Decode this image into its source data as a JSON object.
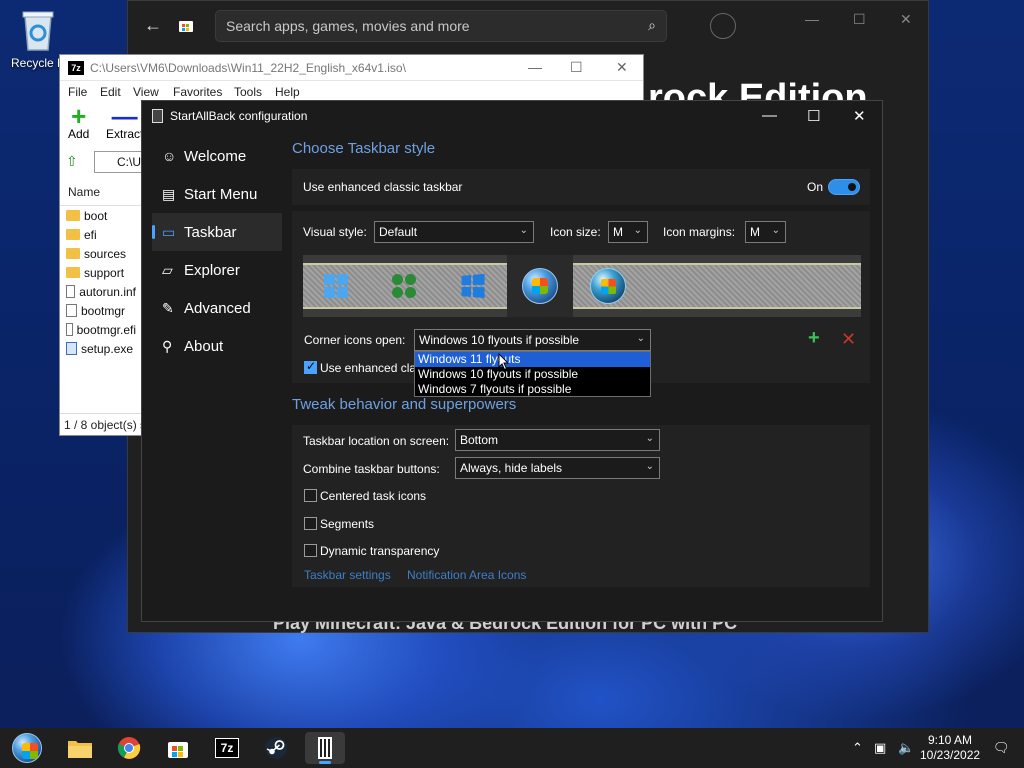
{
  "desktop": {
    "recycle_bin_label": "Recycle B"
  },
  "store_window": {
    "search_placeholder": "Search apps, games, movies and more",
    "hero_title": "rock Edition",
    "hero_subtitle": "Play Minecraft: Java & Bedrock Edition for PC with PC"
  },
  "sevenzip_window": {
    "title_path": "C:\\Users\\VM6\\Downloads\\Win11_22H2_English_x64v1.iso\\",
    "menu": [
      "File",
      "Edit",
      "View",
      "Favorites",
      "Tools",
      "Help"
    ],
    "toolbar": {
      "add": "Add",
      "extract": "Extract"
    },
    "address_fragment": "C:\\U",
    "column_name": "Name",
    "files": [
      {
        "name": "boot",
        "type": "folder"
      },
      {
        "name": "efi",
        "type": "folder"
      },
      {
        "name": "sources",
        "type": "folder"
      },
      {
        "name": "support",
        "type": "folder"
      },
      {
        "name": "autorun.inf",
        "type": "file"
      },
      {
        "name": "bootmgr",
        "type": "file"
      },
      {
        "name": "bootmgr.efi",
        "type": "file"
      },
      {
        "name": "setup.exe",
        "type": "exe"
      }
    ],
    "status": "1 / 8 object(s) s"
  },
  "sab_dialog": {
    "title": "StartAllBack configuration",
    "nav": [
      {
        "label": "Welcome",
        "icon": "smile-icon",
        "active": false
      },
      {
        "label": "Start Menu",
        "icon": "start-menu-icon",
        "active": false
      },
      {
        "label": "Taskbar",
        "icon": "taskbar-icon",
        "active": true
      },
      {
        "label": "Explorer",
        "icon": "folder-icon",
        "active": false
      },
      {
        "label": "Advanced",
        "icon": "wrench-icon",
        "active": false
      },
      {
        "label": "About",
        "icon": "about-icon",
        "active": false
      }
    ],
    "section_style_title": "Choose Taskbar style",
    "enhanced_classic_label": "Use enhanced classic taskbar",
    "enhanced_classic_state": "On",
    "visual_style_label": "Visual style:",
    "visual_style_value": "Default",
    "icon_size_label": "Icon size:",
    "icon_size_value": "M",
    "icon_margins_label": "Icon margins:",
    "icon_margins_value": "M",
    "style_icons": [
      "windows-11-logo-icon",
      "windows-8-logo-icon",
      "windows-10-logo-icon",
      "windows-7-orb-icon",
      "windows-vista-orb-icon"
    ],
    "selected_style_index": 3,
    "corner_icons_label": "Corner icons open:",
    "corner_icons_value": "Windows 10 flyouts if possible",
    "corner_icons_options": [
      "Windows 11 flyouts",
      "Windows 10 flyouts if possible",
      "Windows 7 flyouts if possible"
    ],
    "corner_icons_highlighted": 0,
    "use_enhanced_check_label": "Use enhanced clas",
    "use_enhanced_checked": true,
    "section_tweak_title": "Tweak behavior and superpowers",
    "location_label": "Taskbar location on screen:",
    "location_value": "Bottom",
    "combine_label": "Combine taskbar buttons:",
    "combine_value": "Always, hide labels",
    "checkboxes": [
      {
        "label": "Centered task icons",
        "checked": false
      },
      {
        "label": "Segments",
        "checked": false
      },
      {
        "label": "Dynamic transparency",
        "checked": false
      }
    ],
    "links": [
      "Taskbar settings",
      "Notification Area Icons"
    ]
  },
  "taskbar": {
    "apps": [
      "windows-7-start-orb-icon",
      "file-explorer-icon",
      "chrome-icon",
      "store-icon",
      "7zip-icon",
      "steam-icon",
      "startallback-icon"
    ],
    "active_index": 6,
    "time": "9:10 AM",
    "date": "10/23/2022"
  },
  "colors": {
    "accent": "#4aa3ff",
    "section_heading": "#6ea0e0",
    "link": "#3d7fc7",
    "dropdown_highlight": "#1e5fd6",
    "dialog_bg": "#1b1b1b"
  }
}
